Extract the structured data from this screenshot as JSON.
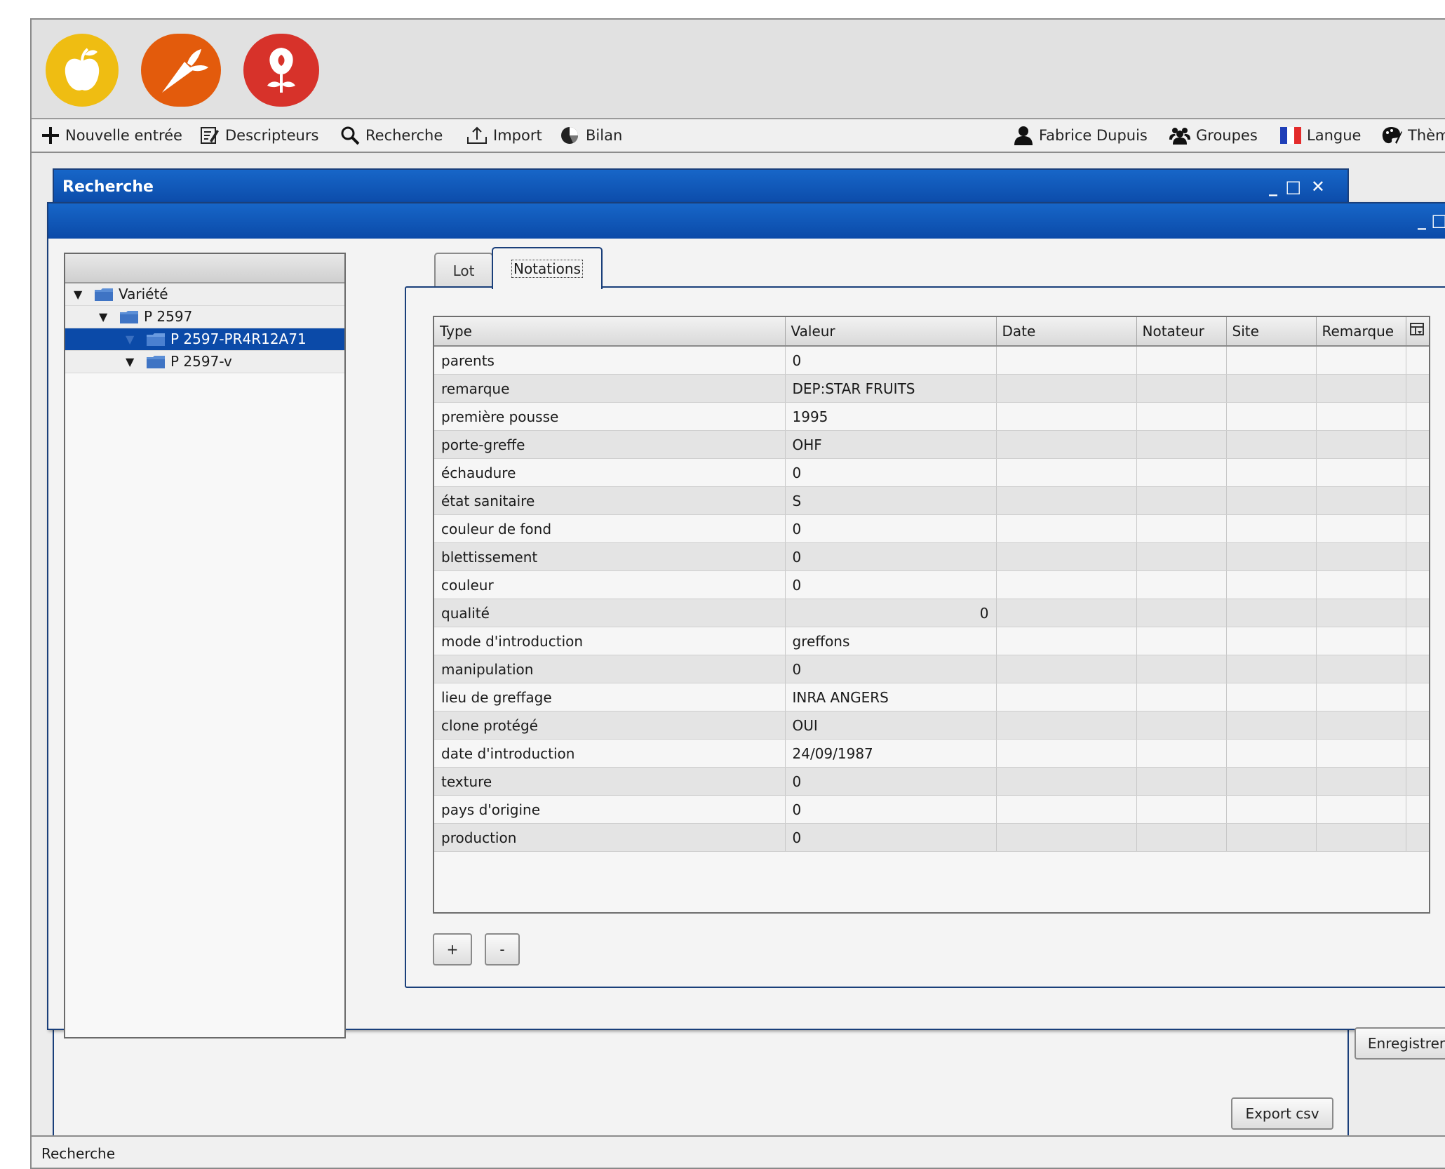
{
  "banner": {
    "logos": [
      {
        "name": "apple-logo",
        "color": "#efbd12"
      },
      {
        "name": "carrot-logo",
        "color": "#e35b0c"
      },
      {
        "name": "rose-logo",
        "color": "#d7322a"
      }
    ]
  },
  "menubar": {
    "left": [
      {
        "icon": "plus-icon",
        "label": "Nouvelle entrée"
      },
      {
        "icon": "edit-icon",
        "label": "Descripteurs"
      },
      {
        "icon": "search-icon",
        "label": "Recherche"
      },
      {
        "icon": "upload-icon",
        "label": "Import"
      },
      {
        "icon": "chart-icon",
        "label": "Bilan"
      }
    ],
    "right": [
      {
        "icon": "user-icon",
        "label": "Fabrice Dupuis"
      },
      {
        "icon": "group-icon",
        "label": "Groupes"
      },
      {
        "icon": "flag-icon",
        "label": "Langue"
      },
      {
        "icon": "palette-icon",
        "label": "Thèm"
      }
    ]
  },
  "back_window": {
    "title": "Recherche",
    "export_label": "Export csv",
    "controls": {
      "minimize": "_",
      "maximize": "□",
      "close": "✕"
    }
  },
  "front_window": {
    "title": "",
    "controls": {
      "minimize": "_",
      "maximize": "□",
      "close": "✕"
    },
    "save_label": "Enregistrer"
  },
  "tree": {
    "nodes": [
      {
        "label": "Variété",
        "level": 0,
        "selected": false
      },
      {
        "label": "P 2597",
        "level": 1,
        "selected": false
      },
      {
        "label": "P 2597-PR4R12A71",
        "level": 2,
        "selected": true
      },
      {
        "label": "P 2597-v",
        "level": 2,
        "selected": false
      }
    ]
  },
  "tabs": [
    {
      "label": "Lot",
      "active": false
    },
    {
      "label": "Notations",
      "active": true
    }
  ],
  "table": {
    "columns": [
      "Type",
      "Valeur",
      "Date",
      "Notateur",
      "Site",
      "Remarque"
    ],
    "rows": [
      [
        "parents",
        "0"
      ],
      [
        "remarque",
        "DEP:STAR FRUITS"
      ],
      [
        "première pousse",
        "1995"
      ],
      [
        "porte-greffe",
        "OHF"
      ],
      [
        "échaudure",
        "0"
      ],
      [
        "état sanitaire",
        "S"
      ],
      [
        "couleur de fond",
        "0"
      ],
      [
        "blettissement",
        "0"
      ],
      [
        "couleur",
        "0"
      ],
      [
        "qualité",
        "0"
      ],
      [
        "mode d'introduction",
        "greffons"
      ],
      [
        "manipulation",
        "0"
      ],
      [
        "lieu de greffage",
        "INRA ANGERS"
      ],
      [
        "clone protégé",
        "OUI"
      ],
      [
        "date d'introduction",
        "24/09/1987"
      ],
      [
        "texture",
        "0"
      ],
      [
        "pays d'origine",
        "0"
      ],
      [
        "production",
        "0"
      ]
    ],
    "right_aligned_row": 9
  },
  "buttons": {
    "add": "+",
    "remove": "-"
  },
  "statusbar": {
    "text": "Recherche"
  }
}
